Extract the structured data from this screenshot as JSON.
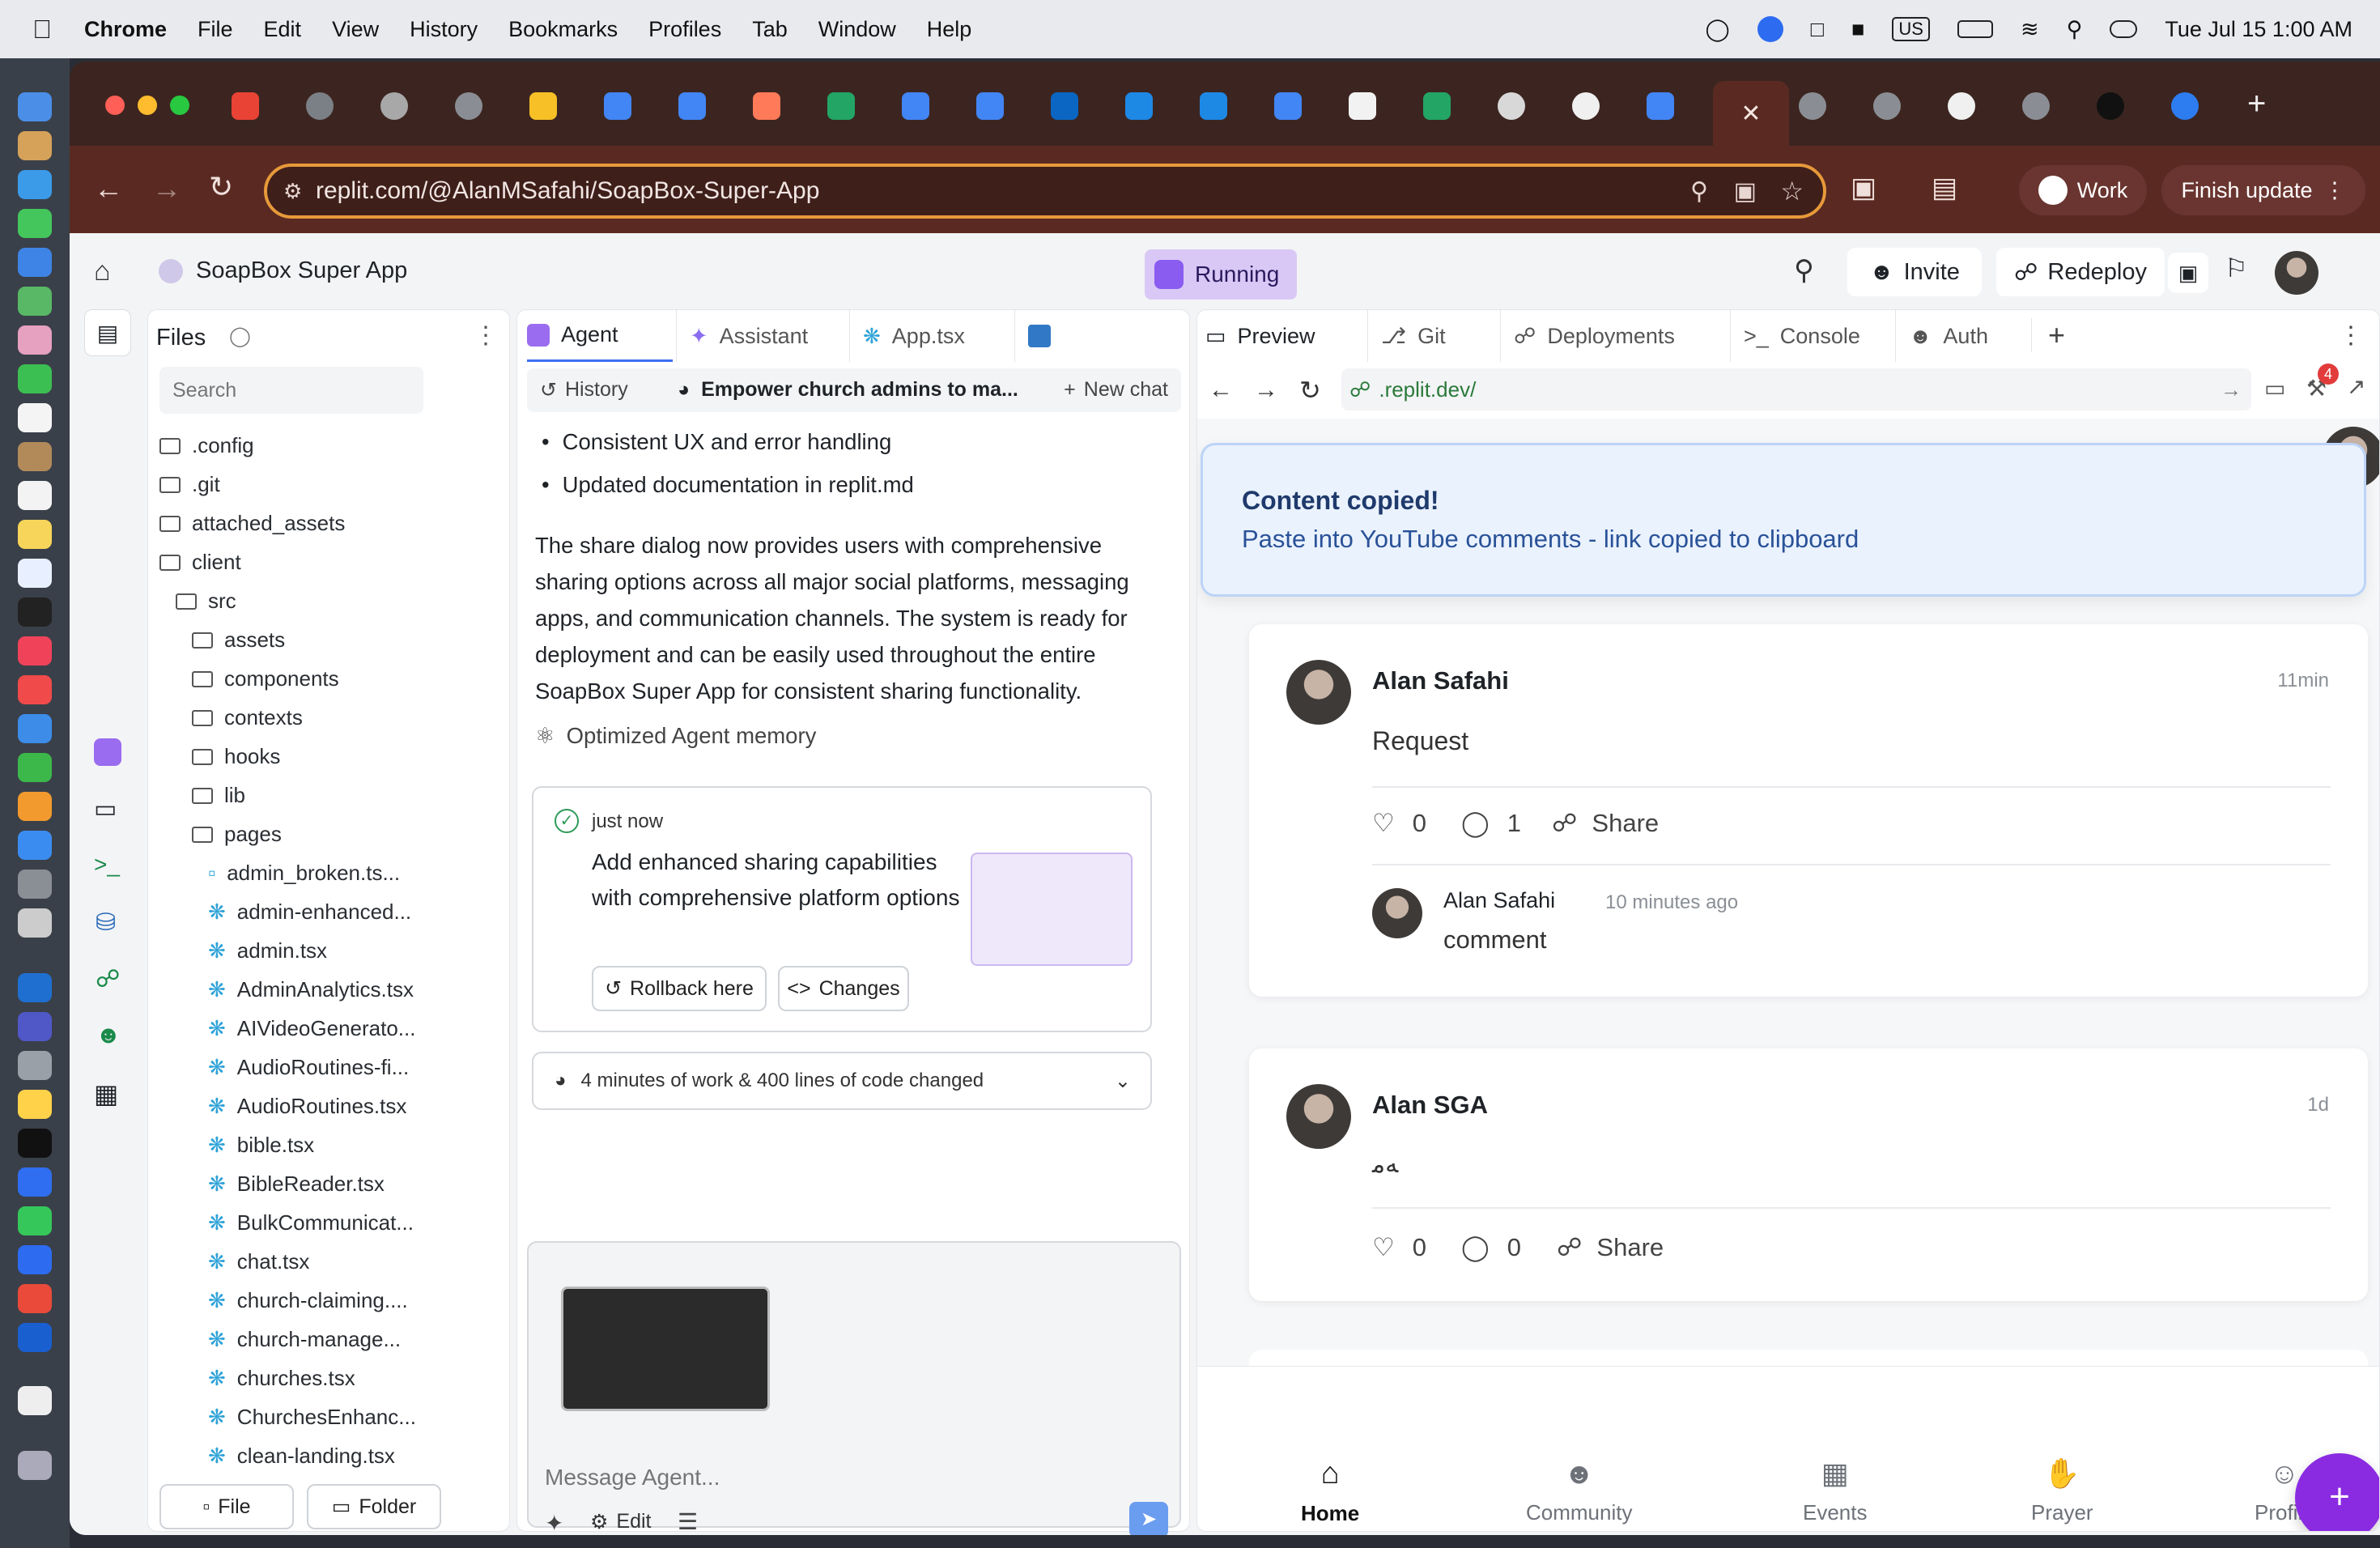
{
  "menubar": {
    "app": "Chrome",
    "items": [
      "File",
      "Edit",
      "View",
      "History",
      "Bookmarks",
      "Profiles",
      "Tab",
      "Window",
      "Help"
    ],
    "clock": "Tue Jul 15  1:00 AM",
    "input_source": "US"
  },
  "browser": {
    "url": "replit.com/@AlanMSafahi/SoapBox-Super-App",
    "profile": "Work",
    "finish_update": "Finish update"
  },
  "replit": {
    "project": "SoapBox Super App",
    "status": "Running",
    "invite": "Invite",
    "redeploy": "Redeploy",
    "files": {
      "title": "Files",
      "search_placeholder": "Search",
      "file_button": "File",
      "folder_button": "Folder",
      "tree": [
        ".config",
        ".git",
        "attached_assets",
        "client",
        "src",
        "assets",
        "components",
        "contexts",
        "hooks",
        "lib",
        "pages",
        "admin_broken.ts...",
        "admin-enhanced...",
        "admin.tsx",
        "AdminAnalytics.tsx",
        "AIVideoGenerato...",
        "AudioRoutines-fi...",
        "AudioRoutines.tsx",
        "bible.tsx",
        "BibleReader.tsx",
        "BulkCommunicat...",
        "chat.tsx",
        "church-claiming....",
        "church-manage...",
        "churches.tsx",
        "ChurchesEnhanc...",
        "clean-landing.tsx"
      ]
    },
    "tabs": {
      "agent": "Agent",
      "assistant": "Assistant",
      "app_tsx": "App.tsx"
    },
    "chat": {
      "history": "History",
      "chat_title": "Empower church admins to ma...",
      "new_chat": "New chat",
      "bullets": [
        "Consistent UX and error handling",
        "Updated documentation in replit.md"
      ],
      "paragraph": "The share dialog now provides users with comprehensive sharing options across all major social platforms, messaging apps, and communication channels. The system is ready for deployment and can be easily used throughout the entire SoapBox Super App for consistent sharing functionality.",
      "memory": "Optimized Agent memory",
      "checkpoint": {
        "time": "just now",
        "message": "Add enhanced sharing capabilities with comprehensive platform options",
        "rollback": "Rollback here",
        "changes": "Changes"
      },
      "work_summary": "4 minutes of work & 400 lines of code changed",
      "input_placeholder": "Message Agent...",
      "edit": "Edit"
    },
    "preview_tabs": {
      "preview": "Preview",
      "git": "Git",
      "deployments": "Deployments",
      "console": "Console",
      "auth": "Auth"
    },
    "preview_url": ".replit.dev/",
    "badge_count": "4"
  },
  "app": {
    "toast": {
      "title": "Content copied!",
      "body": "Paste into YouTube comments - link copied to clipboard"
    },
    "posts": [
      {
        "author": "Alan Safahi",
        "time": "11min",
        "body": "Request",
        "likes": "0",
        "comments": "1",
        "share": "Share",
        "reply": {
          "author": "Alan Safahi",
          "time": "10 minutes ago",
          "body": "comment"
        }
      },
      {
        "author": "Alan SGA",
        "time": "1d",
        "body": "ﻪﻣ",
        "likes": "0",
        "comments": "0",
        "share": "Share"
      }
    ],
    "nav": [
      "Home",
      "Community",
      "Events",
      "Prayer",
      "Profile"
    ],
    "fab": "+"
  }
}
